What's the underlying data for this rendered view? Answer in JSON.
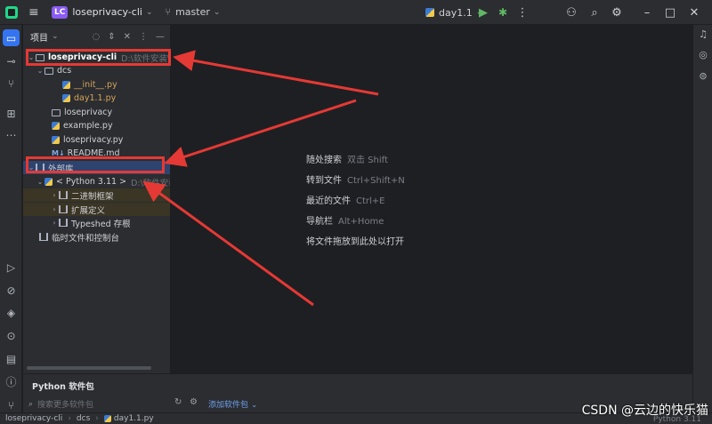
{
  "titlebar": {
    "project_badge": "LC",
    "project_name": "loseprivacy-cli",
    "branch": "master",
    "run_config": "day1.1"
  },
  "project_panel": {
    "title": "项目",
    "tree": [
      {
        "label": "loseprivacy-cli",
        "path": "D:\\软件安装\\社子"
      },
      {
        "label": "dcs"
      },
      {
        "label": "__init__.py"
      },
      {
        "label": "day1.1.py"
      },
      {
        "label": "loseprivacy"
      },
      {
        "label": "example.py"
      },
      {
        "label": "loseprivacy.py"
      },
      {
        "label": "README.md"
      },
      {
        "label": "外部库"
      },
      {
        "label": "< Python 3.11 >",
        "path": "D:\\软件安装\\p"
      },
      {
        "label": "二进制框架"
      },
      {
        "label": "扩展定义"
      },
      {
        "label": "Typeshed 存根"
      },
      {
        "label": "临时文件和控制台"
      }
    ]
  },
  "editor_hints": [
    {
      "label": "随处搜索",
      "key": "双击 Shift"
    },
    {
      "label": "转到文件",
      "key": "Ctrl+Shift+N"
    },
    {
      "label": "最近的文件",
      "key": "Ctrl+E"
    },
    {
      "label": "导航栏",
      "key": "Alt+Home"
    },
    {
      "label": "将文件拖放到此处以打开",
      "key": ""
    }
  ],
  "python_packages": {
    "title": "Python 软件包",
    "search_placeholder": "搜索更多软件包",
    "add_label": "添加软件包"
  },
  "statusbar": {
    "crumbs": [
      "loseprivacy-cli",
      "dcs",
      "day1.1.py"
    ],
    "interpreter": "Python 3.11"
  },
  "watermark": "CSDN @云边的快乐猫",
  "colors": {
    "annotation": "#e53935",
    "accent": "#3574f0",
    "run": "#5fb865"
  }
}
